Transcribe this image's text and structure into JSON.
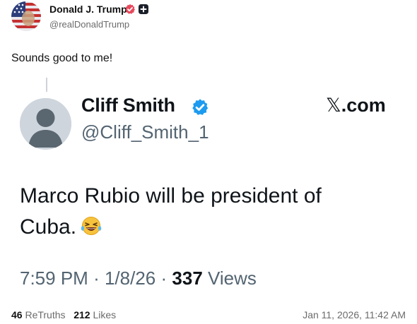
{
  "author": {
    "name": "Donald J. Trump",
    "handle": "@realDonaldTrump"
  },
  "post": {
    "text": "Sounds good to me!"
  },
  "quote": {
    "name": "Cliff Smith",
    "handle": "@Cliff_Smith_1",
    "brand": ".com",
    "text": "Marco Rubio will be president of Cuba.",
    "time": "7:59 PM",
    "sep1": "·",
    "date": "1/8/26",
    "sep2": "·",
    "views_count": "337",
    "views_label": "Views"
  },
  "footer": {
    "retruths_count": "46",
    "retruths_label": "ReTruths",
    "likes_count": "212",
    "likes_label": "Likes",
    "timestamp": "Jan 11, 2026, 11:42 AM"
  },
  "colors": {
    "verified_blue": "#1d9bf0",
    "truth_badge": "#e8495c",
    "muted": "#536471"
  },
  "icons": [
    "flag-avatar-icon",
    "verified-badge-icon",
    "plus-badge-icon",
    "default-avatar-icon",
    "x-logo-icon",
    "laughing-emoji-icon"
  ]
}
